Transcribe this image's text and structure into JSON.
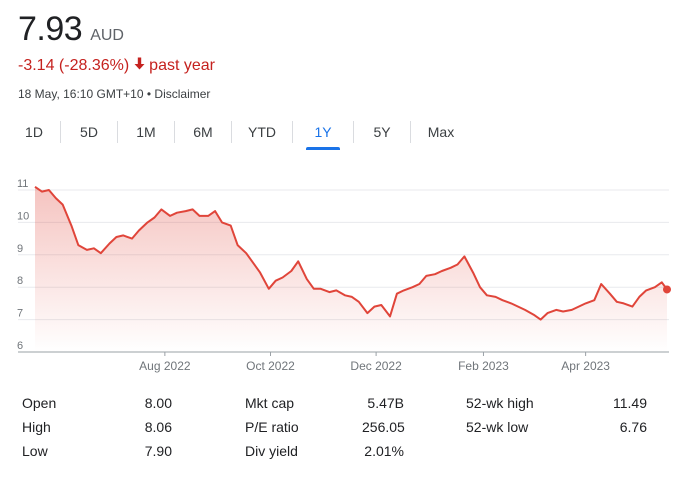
{
  "quote": {
    "price": "7.93",
    "currency": "AUD",
    "change": "-3.14 (-28.36%)",
    "period": "past year",
    "timestamp": "18 May, 16:10 GMT+10",
    "disclaimer": "Disclaimer"
  },
  "colors": {
    "negative": "#c5221f",
    "line": "#e0453a",
    "accent": "#1a73e8"
  },
  "tabs": [
    {
      "label": "1D",
      "active": false
    },
    {
      "label": "5D",
      "active": false
    },
    {
      "label": "1M",
      "active": false
    },
    {
      "label": "6M",
      "active": false
    },
    {
      "label": "YTD",
      "active": false
    },
    {
      "label": "1Y",
      "active": true
    },
    {
      "label": "5Y",
      "active": false
    },
    {
      "label": "Max",
      "active": false
    }
  ],
  "chart_data": {
    "type": "area",
    "title": "",
    "xlabel": "",
    "ylabel": "",
    "ylim": [
      6,
      11
    ],
    "yticks": [
      6,
      7,
      8,
      9,
      10,
      11
    ],
    "grid": true,
    "xticks": [
      {
        "date": "2022-08-01",
        "label": "Aug 2022"
      },
      {
        "date": "2022-10-01",
        "label": "Oct 2022"
      },
      {
        "date": "2022-12-01",
        "label": "Dec 2022"
      },
      {
        "date": "2023-02-01",
        "label": "Feb 2023"
      },
      {
        "date": "2023-04-01",
        "label": "Apr 2023"
      }
    ],
    "x": [
      "2022-05-18",
      "2022-05-22",
      "2022-05-26",
      "2022-05-30",
      "2022-06-03",
      "2022-06-08",
      "2022-06-12",
      "2022-06-17",
      "2022-06-21",
      "2022-06-25",
      "2022-06-30",
      "2022-07-04",
      "2022-07-08",
      "2022-07-13",
      "2022-07-17",
      "2022-07-22",
      "2022-07-26",
      "2022-07-30",
      "2022-08-04",
      "2022-08-08",
      "2022-08-13",
      "2022-08-17",
      "2022-08-21",
      "2022-08-26",
      "2022-08-30",
      "2022-09-03",
      "2022-09-08",
      "2022-09-12",
      "2022-09-17",
      "2022-09-21",
      "2022-09-25",
      "2022-09-30",
      "2022-10-04",
      "2022-10-08",
      "2022-10-13",
      "2022-10-17",
      "2022-10-22",
      "2022-10-26",
      "2022-10-30",
      "2022-11-04",
      "2022-11-08",
      "2022-11-13",
      "2022-11-17",
      "2022-11-21",
      "2022-11-26",
      "2022-11-30",
      "2022-12-04",
      "2022-12-09",
      "2022-12-13",
      "2022-12-17",
      "2022-12-22",
      "2022-12-26",
      "2022-12-30",
      "2023-01-04",
      "2023-01-08",
      "2023-01-13",
      "2023-01-17",
      "2023-01-21",
      "2023-01-26",
      "2023-01-30",
      "2023-02-03",
      "2023-02-08",
      "2023-02-12",
      "2023-02-17",
      "2023-02-21",
      "2023-02-25",
      "2023-03-02",
      "2023-03-06",
      "2023-03-10",
      "2023-03-15",
      "2023-03-19",
      "2023-03-24",
      "2023-03-28",
      "2023-04-01",
      "2023-04-06",
      "2023-04-10",
      "2023-04-15",
      "2023-04-19",
      "2023-04-23",
      "2023-04-28",
      "2023-05-02",
      "2023-05-06",
      "2023-05-11",
      "2023-05-15",
      "2023-05-18"
    ],
    "series": [
      {
        "values": [
          11.1,
          10.95,
          11.0,
          10.75,
          10.55,
          9.9,
          9.3,
          9.15,
          9.2,
          9.05,
          9.35,
          9.55,
          9.6,
          9.5,
          9.75,
          10.0,
          10.15,
          10.4,
          10.2,
          10.3,
          10.35,
          10.4,
          10.2,
          10.2,
          10.35,
          10.0,
          9.9,
          9.3,
          9.05,
          8.75,
          8.45,
          7.95,
          8.2,
          8.3,
          8.5,
          8.8,
          8.25,
          7.95,
          7.95,
          7.85,
          7.9,
          7.75,
          7.7,
          7.55,
          7.2,
          7.4,
          7.45,
          7.1,
          7.8,
          7.9,
          8.0,
          8.1,
          8.35,
          8.4,
          8.5,
          8.6,
          8.7,
          8.95,
          8.45,
          8.0,
          7.75,
          7.7,
          7.6,
          7.5,
          7.4,
          7.3,
          7.15,
          7.0,
          7.2,
          7.3,
          7.25,
          7.3,
          7.4,
          7.5,
          7.6,
          8.1,
          7.8,
          7.55,
          7.5,
          7.4,
          7.7,
          7.9,
          8.0,
          8.15,
          7.93
        ]
      }
    ],
    "last_point": {
      "date": "2023-05-18",
      "value": 7.93
    }
  },
  "stats": {
    "open_label": "Open",
    "open_value": "8.00",
    "high_label": "High",
    "high_value": "8.06",
    "low_label": "Low",
    "low_value": "7.90",
    "mktcap_label": "Mkt cap",
    "mktcap_value": "5.47B",
    "pe_label": "P/E ratio",
    "pe_value": "256.05",
    "div_label": "Div yield",
    "div_value": "2.01%",
    "wk52high_label": "52-wk high",
    "wk52high_value": "11.49",
    "wk52low_label": "52-wk low",
    "wk52low_value": "6.76"
  }
}
